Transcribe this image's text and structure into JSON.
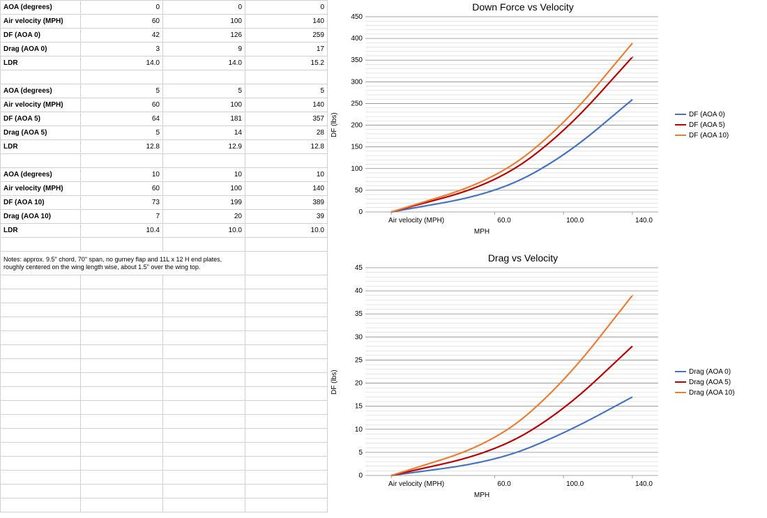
{
  "table": {
    "blocks": [
      {
        "rows": [
          {
            "label": "AOA (degrees)",
            "v": [
              "0",
              "0",
              "0"
            ]
          },
          {
            "label": "Air velocity (MPH)",
            "v": [
              "60",
              "100",
              "140"
            ]
          },
          {
            "label": "DF (AOA 0)",
            "v": [
              "42",
              "126",
              "259"
            ]
          },
          {
            "label": "Drag (AOA 0)",
            "v": [
              "3",
              "9",
              "17"
            ]
          },
          {
            "label": "LDR",
            "v": [
              "14.0",
              "14.0",
              "15.2"
            ]
          }
        ]
      },
      {
        "rows": [
          {
            "label": "AOA (degrees)",
            "v": [
              "5",
              "5",
              "5"
            ]
          },
          {
            "label": "Air velocity (MPH)",
            "v": [
              "60",
              "100",
              "140"
            ]
          },
          {
            "label": "DF (AOA 5)",
            "v": [
              "64",
              "181",
              "357"
            ]
          },
          {
            "label": "Drag (AOA 5)",
            "v": [
              "5",
              "14",
              "28"
            ]
          },
          {
            "label": "LDR",
            "v": [
              "12.8",
              "12.9",
              "12.8"
            ]
          }
        ]
      },
      {
        "rows": [
          {
            "label": "AOA (degrees)",
            "v": [
              "10",
              "10",
              "10"
            ]
          },
          {
            "label": "Air velocity (MPH)",
            "v": [
              "60",
              "100",
              "140"
            ]
          },
          {
            "label": "DF (AOA 10)",
            "v": [
              "73",
              "199",
              "389"
            ]
          },
          {
            "label": "Drag (AOA 10)",
            "v": [
              "7",
              "20",
              "39"
            ]
          },
          {
            "label": "LDR",
            "v": [
              "10.4",
              "10.0",
              "10.0"
            ]
          }
        ]
      }
    ],
    "notes": "Notes: approx. 9.5\" chord, 70\" span, no gurney flap and 11L x 12 H end plates, roughly centered on the wing length wise, about 1.5\" over the wing top."
  },
  "colors": {
    "s0": "#4472c4",
    "s1": "#c00000",
    "s2": "#ed7d31"
  },
  "chart_data": [
    {
      "type": "line",
      "title": "Down Force vs Velocity",
      "ylabel": "DF (lbs)",
      "xlabel": "MPH",
      "x_label_first": "Air velocity (MPH)",
      "x_ticks": [
        "60.0",
        "100.0",
        "140.0"
      ],
      "ylim": [
        0,
        450
      ],
      "ystep": 50,
      "minor": 5,
      "x": [
        0,
        60,
        100,
        140
      ],
      "series": [
        {
          "name": "DF (AOA 0)",
          "values": [
            0,
            42,
            126,
            259
          ],
          "color": "s0"
        },
        {
          "name": "DF (AOA 5)",
          "values": [
            0,
            64,
            181,
            357
          ],
          "color": "s1"
        },
        {
          "name": "DF (AOA 10)",
          "values": [
            0,
            73,
            199,
            389
          ],
          "color": "s2"
        }
      ]
    },
    {
      "type": "line",
      "title": "Drag vs Velocity",
      "ylabel": "DF (lbs)",
      "xlabel": "MPH",
      "x_label_first": "Air velocity (MPH)",
      "x_ticks": [
        "60.0",
        "100.0",
        "140.0"
      ],
      "ylim": [
        0,
        45
      ],
      "ystep": 5,
      "minor": 5,
      "x": [
        0,
        60,
        100,
        140
      ],
      "series": [
        {
          "name": "Drag (AOA 0)",
          "values": [
            0,
            3,
            9,
            17
          ],
          "color": "s0"
        },
        {
          "name": "Drag (AOA 5)",
          "values": [
            0,
            5,
            14,
            28
          ],
          "color": "s1"
        },
        {
          "name": "Drag (AOA 10)",
          "values": [
            0,
            7,
            20,
            39
          ],
          "color": "s2"
        }
      ]
    }
  ]
}
